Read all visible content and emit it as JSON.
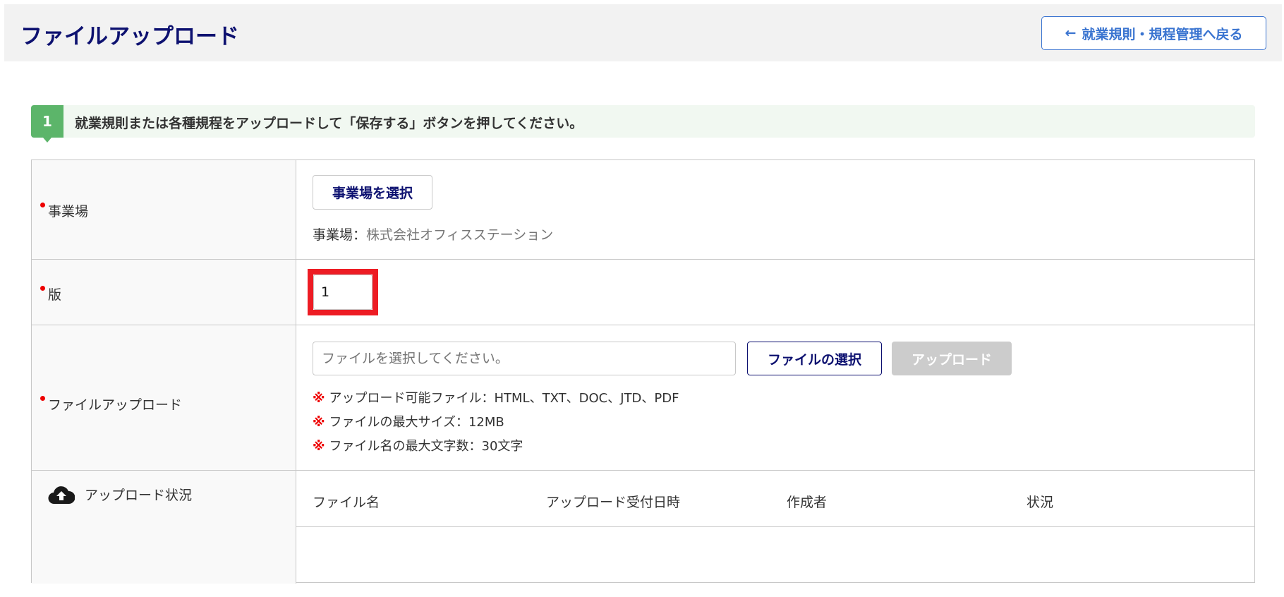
{
  "header": {
    "title": "ファイルアップロード",
    "back_label": "就業規則・規程管理へ戻る"
  },
  "step": {
    "number": "1",
    "text": "就業規則または各種規程をアップロードして「保存する」ボタンを押してください。"
  },
  "form": {
    "workplace": {
      "label": "事業場",
      "button": "事業場を選択",
      "selected_prefix": "事業場：",
      "selected_value": "株式会社オフィスステーション"
    },
    "edition": {
      "label": "版",
      "value": "1"
    },
    "file": {
      "label": "ファイルアップロード",
      "placeholder": "ファイルを選択してください。",
      "select_button": "ファイルの選択",
      "upload_button": "アップロード",
      "notes": [
        {
          "mark": "※",
          "text": "アップロード可能ファイル：HTML、TXT、DOC、JTD、PDF"
        },
        {
          "mark": "※",
          "text": "ファイルの最大サイズ：12MB"
        },
        {
          "mark": "※",
          "text": "ファイル名の最大文字数：30文字"
        }
      ]
    },
    "status": {
      "label": "アップロード状況",
      "columns": [
        "ファイル名",
        "アップロード受付日時",
        "作成者",
        "状況"
      ]
    }
  },
  "colors": {
    "title": "#0d1170",
    "accent": "#3a74d0",
    "step_green": "#5cb56a",
    "required": "#ee0000",
    "highlight": "#ed1c24"
  }
}
